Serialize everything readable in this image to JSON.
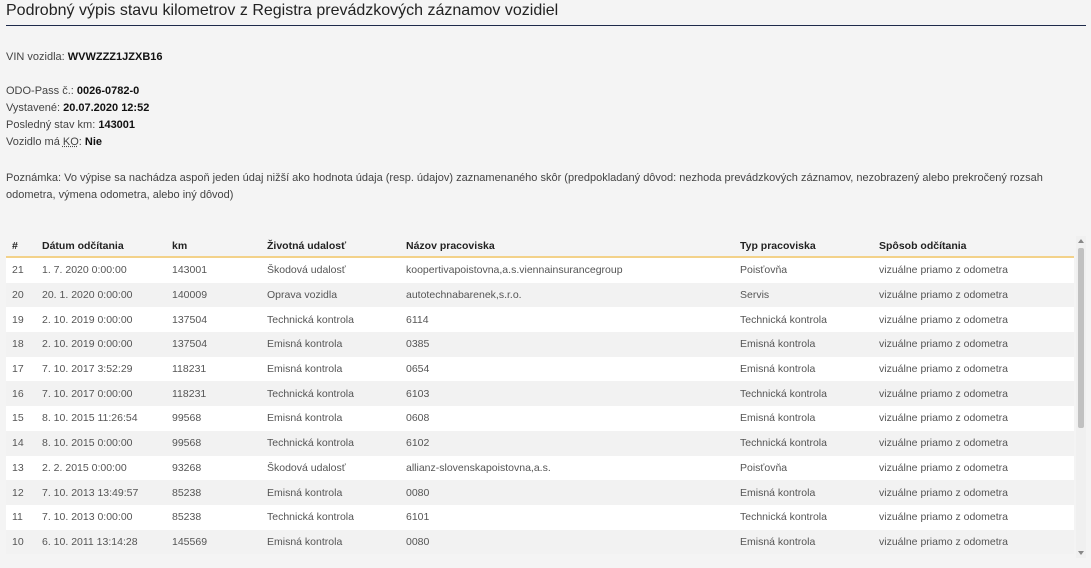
{
  "page": {
    "title": "Podrobný výpis stavu kilometrov z Registra prevádzkových záznamov vozidiel"
  },
  "vehicle": {
    "vin_label": "VIN vozidla:",
    "vin_value": "WVWZZZ1JZXB16",
    "odo_label": "ODO-Pass č.:",
    "odo_value": "0026-0782-0",
    "issued_label": "Vystavené:",
    "issued_value": "20.07.2020 12:52",
    "last_km_label": "Posledný stav km:",
    "last_km_value": "143001",
    "ko_label_prefix": "Vozidlo má",
    "ko_abbr": "KO",
    "ko_label_suffix": ":",
    "ko_value": "Nie"
  },
  "note": "Poznámka: Vo výpise sa nachádza aspoň jeden údaj nižší ako hodnota údaja (resp. údajov) zaznamenaného skôr (predpokladaný dôvod: nezhoda prevádzkových záznamov, nezobrazený alebo prekročený rozsah odometra, výmena odometra, alebo iný dôvod)",
  "table": {
    "columns": [
      "#",
      "Dátum odčítania",
      "km",
      "Životná udalosť",
      "Názov pracoviska",
      "Typ pracoviska",
      "Spôsob odčítania"
    ],
    "rows": [
      [
        "21",
        "1. 7. 2020 0:00:00",
        "143001",
        "Škodová udalosť",
        "koopertivapoistovna,a.s.viennainsurancegroup",
        "Poisťovňa",
        "vizuálne priamo z odometra"
      ],
      [
        "20",
        "20. 1. 2020 0:00:00",
        "140009",
        "Oprava vozidla",
        "autotechnabarenek,s.r.o.",
        "Servis",
        "vizuálne priamo z odometra"
      ],
      [
        "19",
        "2. 10. 2019 0:00:00",
        "137504",
        "Technická kontrola",
        "6114",
        "Technická kontrola",
        "vizuálne priamo z odometra"
      ],
      [
        "18",
        "2. 10. 2019 0:00:00",
        "137504",
        "Emisná kontrola",
        "0385",
        "Emisná kontrola",
        "vizuálne priamo z odometra"
      ],
      [
        "17",
        "7. 10. 2017 3:52:29",
        "118231",
        "Emisná kontrola",
        "0654",
        "Emisná kontrola",
        "vizuálne priamo z odometra"
      ],
      [
        "16",
        "7. 10. 2017 0:00:00",
        "118231",
        "Technická kontrola",
        "6103",
        "Technická kontrola",
        "vizuálne priamo z odometra"
      ],
      [
        "15",
        "8. 10. 2015 11:26:54",
        "99568",
        "Emisná kontrola",
        "0608",
        "Emisná kontrola",
        "vizuálne priamo z odometra"
      ],
      [
        "14",
        "8. 10. 2015 0:00:00",
        "99568",
        "Technická kontrola",
        "6102",
        "Technická kontrola",
        "vizuálne priamo z odometra"
      ],
      [
        "13",
        "2. 2. 2015 0:00:00",
        "93268",
        "Škodová udalosť",
        "allianz-slovenskapoistovna,a.s.",
        "Poisťovňa",
        "vizuálne priamo z odometra"
      ],
      [
        "12",
        "7. 10. 2013 13:49:57",
        "85238",
        "Emisná kontrola",
        "0080",
        "Emisná kontrola",
        "vizuálne priamo z odometra"
      ],
      [
        "11",
        "7. 10. 2013 0:00:00",
        "85238",
        "Technická kontrola",
        "6101",
        "Technická kontrola",
        "vizuálne priamo z odometra"
      ],
      [
        "10",
        "6. 10. 2011 13:14:28",
        "145569",
        "Emisná kontrola",
        "0080",
        "Emisná kontrola",
        "vizuálne priamo z odometra"
      ]
    ]
  }
}
